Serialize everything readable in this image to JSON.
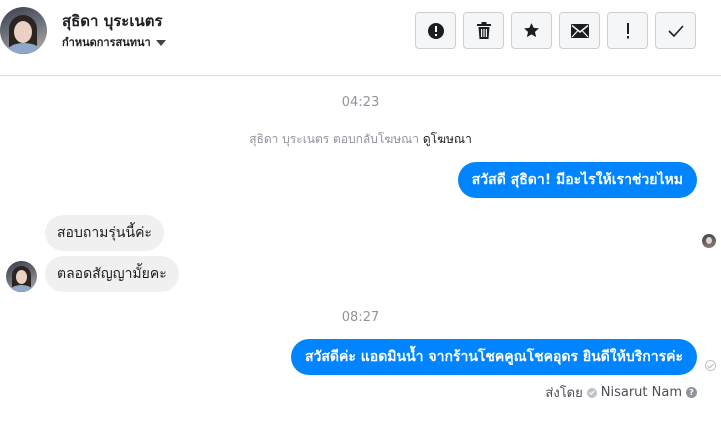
{
  "header": {
    "contact_name": "สุธิดา บุระเนตร",
    "assign_label": "กำหนดการสนทนา",
    "actions": [
      {
        "name": "report-spam-button",
        "icon": "alert-circle-icon"
      },
      {
        "name": "delete-button",
        "icon": "trash-icon"
      },
      {
        "name": "star-button",
        "icon": "star-icon"
      },
      {
        "name": "mark-unread-button",
        "icon": "envelope-icon"
      },
      {
        "name": "follow-up-button",
        "icon": "exclamation-icon"
      },
      {
        "name": "mark-done-button",
        "icon": "checkmark-icon"
      }
    ]
  },
  "conversation": {
    "time_1": "04:23",
    "system_prefix": "สุธิดา บุระเนตร ตอบกลับโฆษณา",
    "system_link": "ดูโฆษณา",
    "outgoing_1": "สวัสดี สุธิดา! มีอะไรให้เราช่วยไหม",
    "incoming_1": "สอบถามรุ่นนี้ค่ะ",
    "incoming_2": "ตลอดสัญญามั้ยคะ",
    "time_2": "08:27",
    "outgoing_2": "สวัสดีค่ะ แอดมินน้ำ จากร้านโชคคูณโชคอุดร ยินดีให้บริการค่ะ",
    "sent_by_label": "ส่งโดย",
    "sender_name": "Nisarut Nam",
    "help_glyph": "?"
  },
  "colors": {
    "outgoing_bubble": "#0084ff",
    "incoming_bubble": "#f1f0f0",
    "muted_text": "#90949c"
  }
}
